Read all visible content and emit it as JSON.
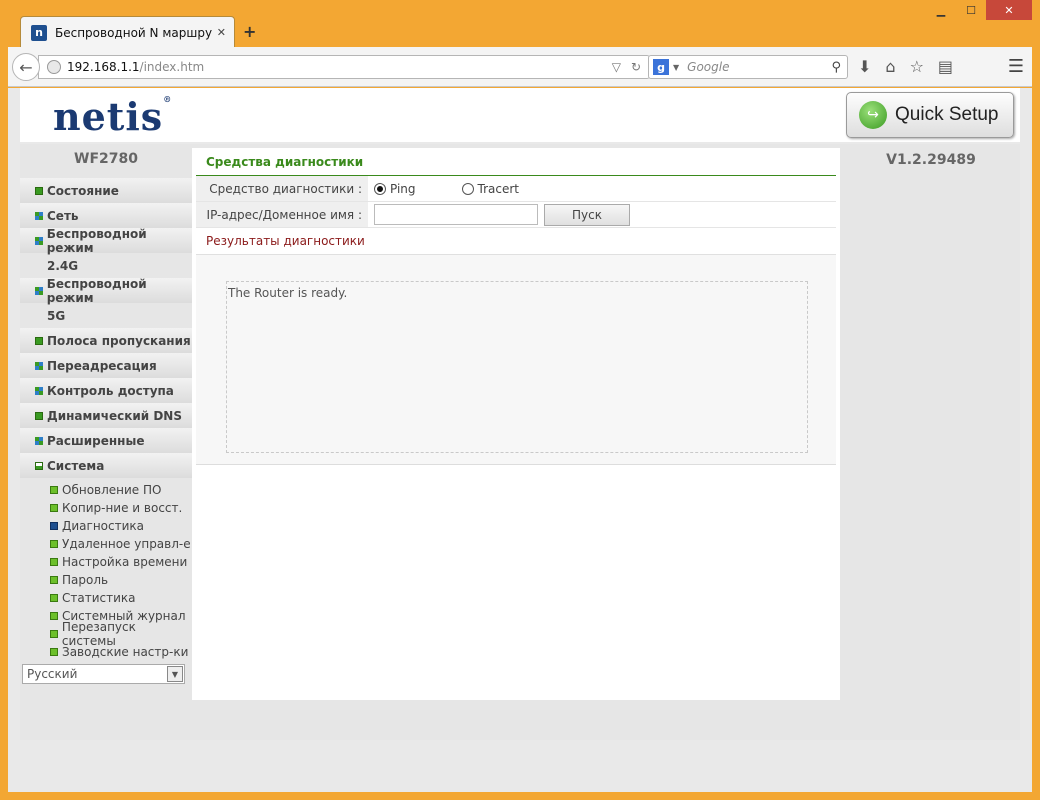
{
  "browser": {
    "tab_title": "Беспроводной N маршру…",
    "tab_favicon": "n",
    "tab_close": "✕",
    "new_tab": "+",
    "url_host": "192.168.1.1",
    "url_path": "/index.htm",
    "search_placeholder": "Google",
    "window_controls": {
      "minimize": "▁",
      "maximize": "☐",
      "close": "✕"
    }
  },
  "header": {
    "logo_text": "netis",
    "quick_setup_label": "Quick Setup"
  },
  "device": {
    "model": "WF2780",
    "version": "V1.2.29489"
  },
  "sidebar": {
    "items": [
      {
        "label": "Состояние",
        "icon": "plus"
      },
      {
        "label": "Сеть",
        "icon": "grid"
      },
      {
        "label": "Беспроводной режим",
        "icon": "grid"
      },
      {
        "label": "2.4G",
        "icon": "none",
        "cont": true
      },
      {
        "label": "Беспроводной режим",
        "icon": "grid"
      },
      {
        "label": "5G",
        "icon": "none",
        "cont": true
      },
      {
        "label": "Полоса пропускания",
        "icon": "plus"
      },
      {
        "label": "Переадресация",
        "icon": "grid"
      },
      {
        "label": "Контроль доступа",
        "icon": "grid"
      },
      {
        "label": "Динамический DNS",
        "icon": "plus"
      },
      {
        "label": "Расширенные",
        "icon": "grid"
      },
      {
        "label": "Система",
        "icon": "minus"
      }
    ],
    "sub_items": [
      "Обновление ПО",
      "Копир-ние и восст.",
      "Диагностика",
      "Удаленное управл-е",
      "Настройка времени",
      "Пароль",
      "Статистика",
      "Системный журнал",
      "Перезапуск системы",
      "Заводские настр-ки"
    ],
    "active_sub": 2,
    "language": "Русский"
  },
  "main": {
    "section_title": "Средства диагностики",
    "tool_label": "Средство диагностики :",
    "tool_options": [
      "Ping",
      "Tracert"
    ],
    "tool_selected": "Ping",
    "ip_label": "IP-адрес/Доменное имя :",
    "ip_value": "",
    "start_button": "Пуск",
    "results_title": "Результаты диагностики",
    "results_text": "The Router is ready."
  },
  "colors": {
    "accent_green": "#3a8a1c",
    "results_red": "#8b1a1a",
    "logo_blue": "#1b3a72",
    "window_frame": "#f3a733"
  }
}
